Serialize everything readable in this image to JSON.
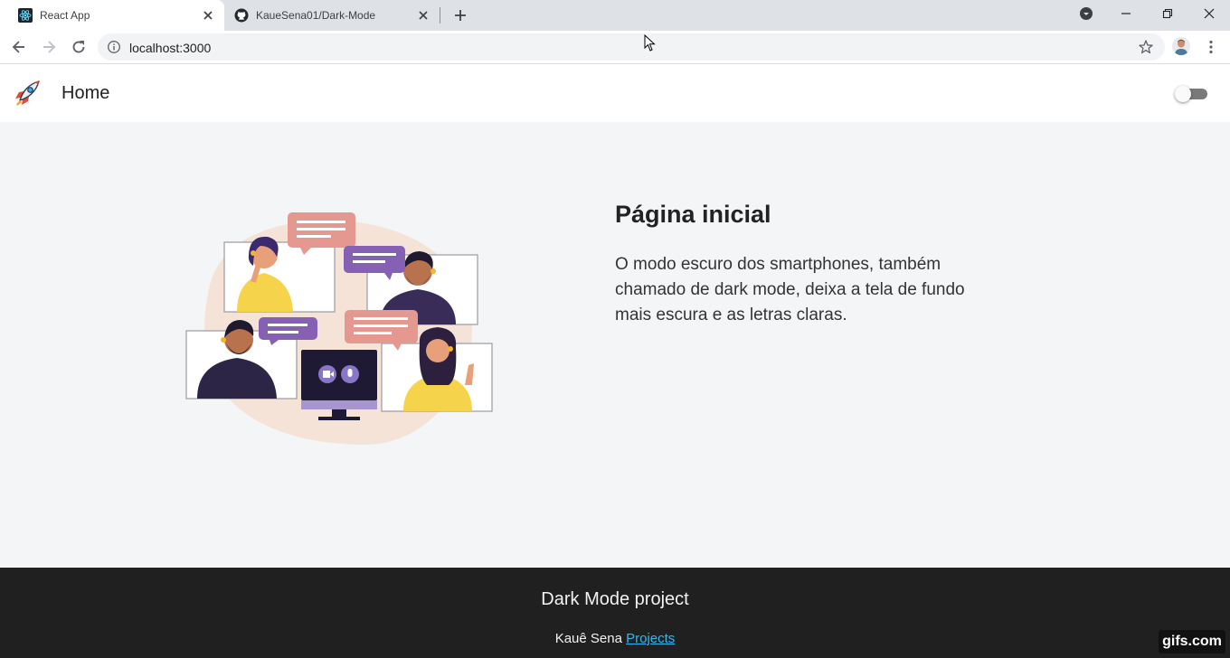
{
  "browser": {
    "tabs": [
      {
        "title": "React App",
        "favicon": "react-icon",
        "active": true
      },
      {
        "title": "KaueSena01/Dark-Mode",
        "favicon": "github-icon",
        "active": false
      }
    ],
    "address": "localhost:3000",
    "icons": [
      "back-icon",
      "forward-icon",
      "reload-icon",
      "info-icon",
      "star-icon",
      "profile-avatar",
      "menu-icon",
      "minimize-icon",
      "restore-icon",
      "close-icon",
      "new-tab-icon",
      "tab-search-icon"
    ]
  },
  "navbar": {
    "logo_icon": "rocket-icon",
    "home_label": "Home",
    "theme_toggle_on": false
  },
  "content": {
    "title": "Página inicial",
    "description": "O modo escuro dos smartphones, também chamado de dark mode, deixa a tela de fundo mais escura e as letras claras.",
    "illustration": "video-conference-illustration"
  },
  "footer": {
    "title": "Dark Mode project",
    "author": "Kauê Sena",
    "link_label": "Projects"
  },
  "watermark": "gifs.com",
  "colors": {
    "page_bg": "#f4f5f7",
    "footer_bg": "#202020",
    "link": "#2fb7f0",
    "toggle_track": "#7a7a7a"
  }
}
